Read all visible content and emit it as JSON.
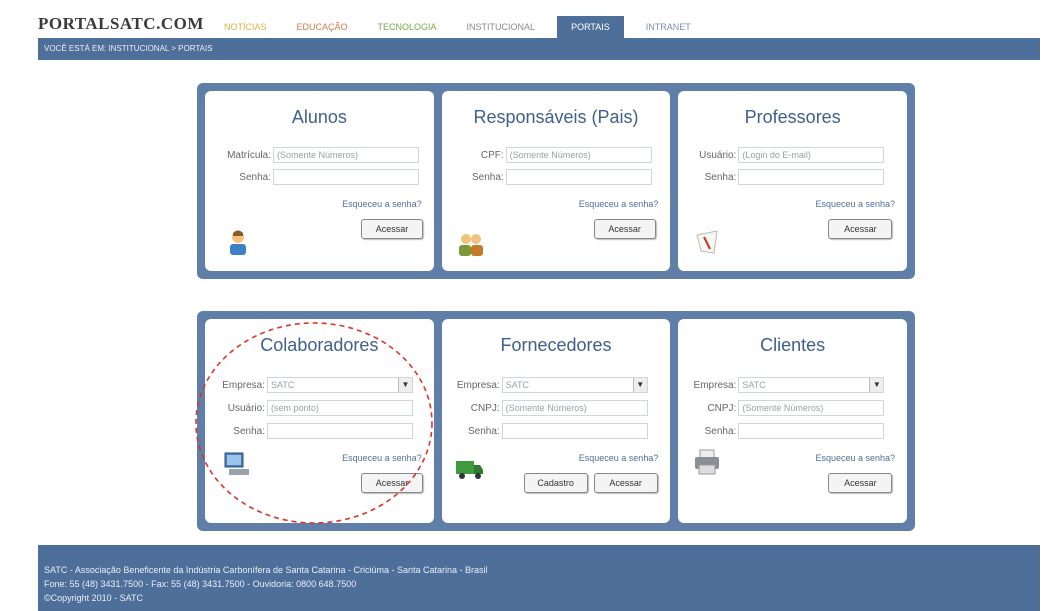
{
  "header": {
    "logo": "PORTALSATC.COM",
    "nav": [
      {
        "label": "Notícias",
        "color": "#d9b24a"
      },
      {
        "label": "Educação",
        "color": "#d07a4a"
      },
      {
        "label": "Tecnologia",
        "color": "#7aa84a"
      },
      {
        "label": "Institucional",
        "color": "#8a8a8a"
      },
      {
        "label": "Portais",
        "color": "#ffffff",
        "active": true
      },
      {
        "label": "Intranet",
        "color": "#7f8fa8"
      }
    ],
    "breadcrumb": "Você está em: Institucional > Portais"
  },
  "cards": {
    "alunos": {
      "title": "Alunos",
      "field1_label": "Matrícula:",
      "field1_placeholder": "(Somente Números)",
      "field2_label": "Senha:",
      "forgot": "Esqueceu a senha?",
      "button": "Acessar"
    },
    "responsaveis": {
      "title": "Responsáveis (Pais)",
      "field1_label": "CPF:",
      "field1_placeholder": "(Somente Números)",
      "field2_label": "Senha:",
      "forgot": "Esqueceu a senha?",
      "button": "Acessar"
    },
    "professores": {
      "title": "Professores",
      "field1_label": "Usuário:",
      "field1_placeholder": "(Login do E-mail)",
      "field2_label": "Senha:",
      "forgot": "Esqueceu a senha?",
      "button": "Acessar"
    },
    "colaboradores": {
      "title": "Colaboradores",
      "company_label": "Empresa:",
      "company_value": "SATC",
      "user_label": "Usuário:",
      "user_value": "(sem ponto)",
      "password_label": "Senha:",
      "forgot": "Esqueceu a senha?",
      "button": "Acessar"
    },
    "fornecedores": {
      "title": "Fornecedores",
      "company_label": "Empresa:",
      "company_value": "SATC",
      "cnpj_label": "CNPJ:",
      "cnpj_placeholder": "(Somente Números)",
      "password_label": "Senha:",
      "forgot": "Esqueceu a senha?",
      "register_button": "Cadastro",
      "button": "Acessar"
    },
    "clientes": {
      "title": "Clientes",
      "company_label": "Empresa:",
      "company_value": "SATC",
      "cnpj_label": "CNPJ:",
      "cnpj_placeholder": "(Somente Números)",
      "password_label": "Senha:",
      "forgot": "Esqueceu a senha?",
      "button": "Acessar"
    }
  },
  "footer": {
    "line1": "SATC - Associação Beneficente da Indústria Carbonífera de Santa Catarina - Criciúma - Santa Catarina - Brasil",
    "line2": "Fone: 55 (48) 3431.7500 - Fax: 55 (48) 3431.7500 - Ouvidoria: 0800 648.7500",
    "line3": "©Copyright 2010 - SATC"
  },
  "colors": {
    "accent": "#4f6f9b",
    "panel": "#5f7ea8",
    "title": "#3f5f8c",
    "annotation": "#d9342b"
  }
}
